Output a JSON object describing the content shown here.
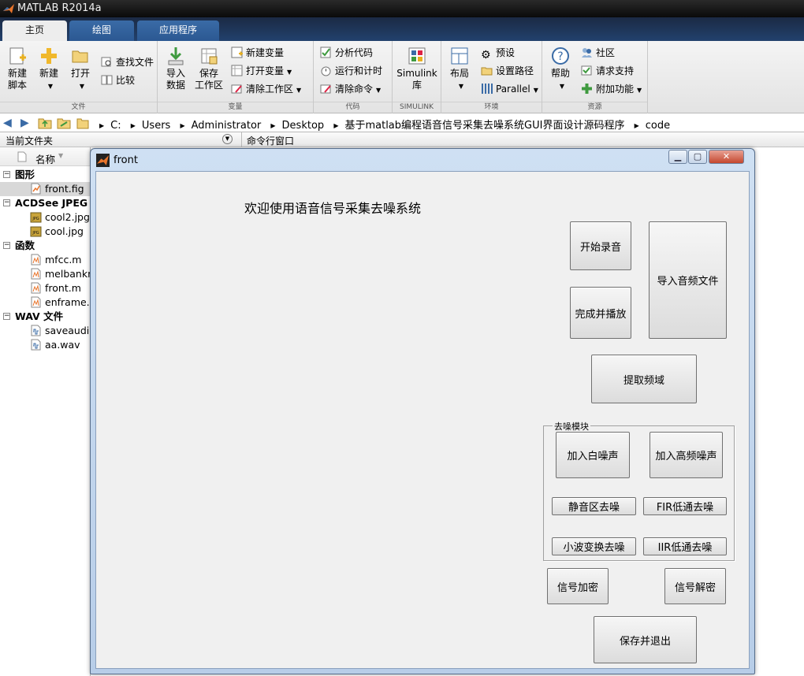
{
  "app": {
    "title": "MATLAB R2014a"
  },
  "tabs": [
    {
      "label": "主页",
      "active": true
    },
    {
      "label": "绘图",
      "active": false
    },
    {
      "label": "应用程序",
      "active": false
    }
  ],
  "ribbon": {
    "file": {
      "label": "文件",
      "new_script": "新建\n脚本",
      "new": "新建",
      "open": "打开",
      "find_files": "查找文件",
      "compare": "比较"
    },
    "variable": {
      "label": "变量",
      "import_data": "导入\n数据",
      "save_workspace": "保存\n工作区",
      "new_variable": "新建变量",
      "open_variable": "打开变量",
      "clear_workspace": "清除工作区"
    },
    "code": {
      "label": "代码",
      "analyze_code": "分析代码",
      "run_and_time": "运行和计时",
      "clear_commands": "清除命令"
    },
    "simulink": {
      "label": "SIMULINK",
      "simulink_library": "Simulink\n库"
    },
    "environment": {
      "label": "环境",
      "layout": "布局",
      "preferences": "预设",
      "set_path": "设置路径",
      "parallel": "Parallel"
    },
    "resources": {
      "label": "资源",
      "help": "帮助",
      "community": "社区",
      "request_support": "请求支持",
      "add_ons": "附加功能"
    }
  },
  "address": {
    "crumbs": [
      "C:",
      "Users",
      "Administrator",
      "Desktop",
      "基于matlab编程语音信号采集去噪系统GUI界面设计源码程序",
      "code"
    ]
  },
  "panels": {
    "current_folder": "当前文件夹",
    "command_window": "命令行窗口"
  },
  "file_browser": {
    "name_header": "名称",
    "items": [
      {
        "kind": "group",
        "label": "图形"
      },
      {
        "kind": "file",
        "label": "front.fig",
        "icon": "fig-file-icon",
        "selected": true
      },
      {
        "kind": "group",
        "label": "ACDSee JPEG 图"
      },
      {
        "kind": "file",
        "label": "cool2.jpg",
        "icon": "jpg-file-icon"
      },
      {
        "kind": "file",
        "label": "cool.jpg",
        "icon": "jpg-file-icon"
      },
      {
        "kind": "group",
        "label": "函数"
      },
      {
        "kind": "file",
        "label": "mfcc.m",
        "icon": "m-file-icon"
      },
      {
        "kind": "file",
        "label": "melbankm",
        "icon": "m-file-icon"
      },
      {
        "kind": "file",
        "label": "front.m",
        "icon": "m-file-icon"
      },
      {
        "kind": "file",
        "label": "enframe.m",
        "icon": "m-file-icon"
      },
      {
        "kind": "group",
        "label": "WAV 文件"
      },
      {
        "kind": "file",
        "label": "saveaudio",
        "icon": "wav-file-icon"
      },
      {
        "kind": "file",
        "label": "aa.wav",
        "icon": "wav-file-icon"
      }
    ]
  },
  "figure": {
    "title": "front",
    "welcome": "欢迎使用语音信号采集去噪系统",
    "buttons": {
      "start_record": "开始录音",
      "import_audio": "导入音频文件",
      "finish_play": "完成并播放",
      "extract_freq": "提取频域",
      "add_white": "加入白噪声",
      "add_highfreq": "加入高频噪声",
      "silence_denoise": "静音区去噪",
      "fir_lowpass": "FIR低通去噪",
      "wavelet_denoise": "小波变换去噪",
      "iir_lowpass": "IIR低通去噪",
      "encrypt": "信号加密",
      "decrypt": "信号解密",
      "save_exit": "保存并退出"
    },
    "denoise_panel_title": "去噪模块"
  },
  "colors": {
    "accent": "#2b5892",
    "titlebar": "#0a0a0a",
    "figure_bg": "#f0f0f0"
  }
}
